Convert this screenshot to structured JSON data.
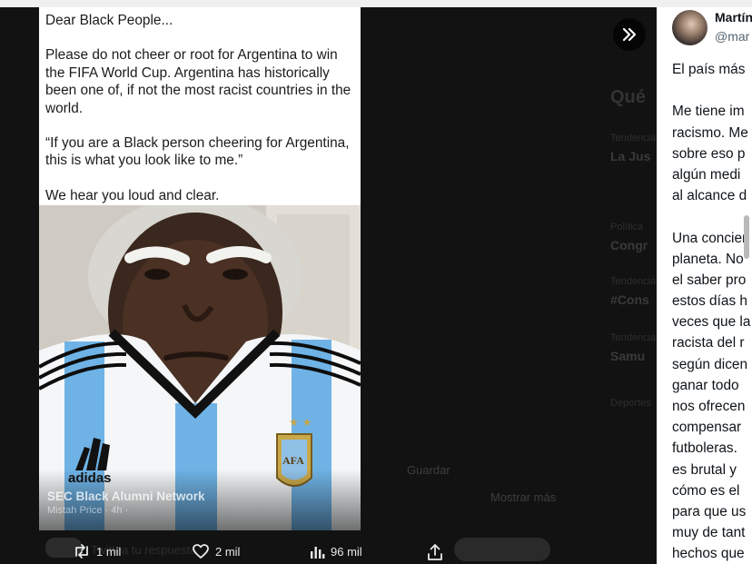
{
  "post": {
    "greeting": "Dear Black People...",
    "paragraph1": "Please do not cheer or root for Argentina to win the FIFA World Cup. Argentina has historically been one of, if not the most racist countries in the world.",
    "paragraph2": "“If you are a Black person cheering for Argentina, this is what you look like to me.”",
    "paragraph3": "We hear you loud and clear.",
    "overlay_name": "SEC Black Alumni Network",
    "overlay_sub": "Mistah Price · 4h ·"
  },
  "image": {
    "jersey_brand": "adidas",
    "badge": "AFA"
  },
  "actions": {
    "retweets": "1 mil",
    "likes": "2 mil",
    "views": "96 mil"
  },
  "author": {
    "name": "Martín",
    "handle": "@mar"
  },
  "body_lines": [
    "El país más",
    "",
    "Me tiene im",
    "racismo. Me",
    "sobre eso p",
    "algún medi",
    "al alcance d",
    "",
    "Una concien",
    "planeta. No",
    "el saber pro",
    "estos días h",
    "veces que la",
    "racista del r",
    "según dicen",
    "ganar todo",
    "nos ofrecen",
    "compensar",
    "futboleras.",
    "es brutal y",
    "cómo es el",
    "para que us",
    "muy de tant",
    "hechos que"
  ],
  "background": {
    "heading": "Qué",
    "item1_small": "Tendencia",
    "item1": "La Jus",
    "item2_small": "Política",
    "item2": "Congr",
    "item3_small": "Tendencia",
    "item3": "#Cons",
    "item4_small": "Tendencia",
    "item4": "Samu",
    "item5_small": "Deportes",
    "save_label": "Guardar",
    "views_label": "Mostrar más",
    "ghost_reply": "Twittea tu respuesta"
  },
  "colors": {
    "backdrop": "#121212",
    "jersey_blue": "#6fb3e6",
    "panel": "#ffffff"
  },
  "icons": [
    "expand-icon",
    "retweet-icon",
    "heart-icon",
    "views-icon",
    "share-icon"
  ]
}
